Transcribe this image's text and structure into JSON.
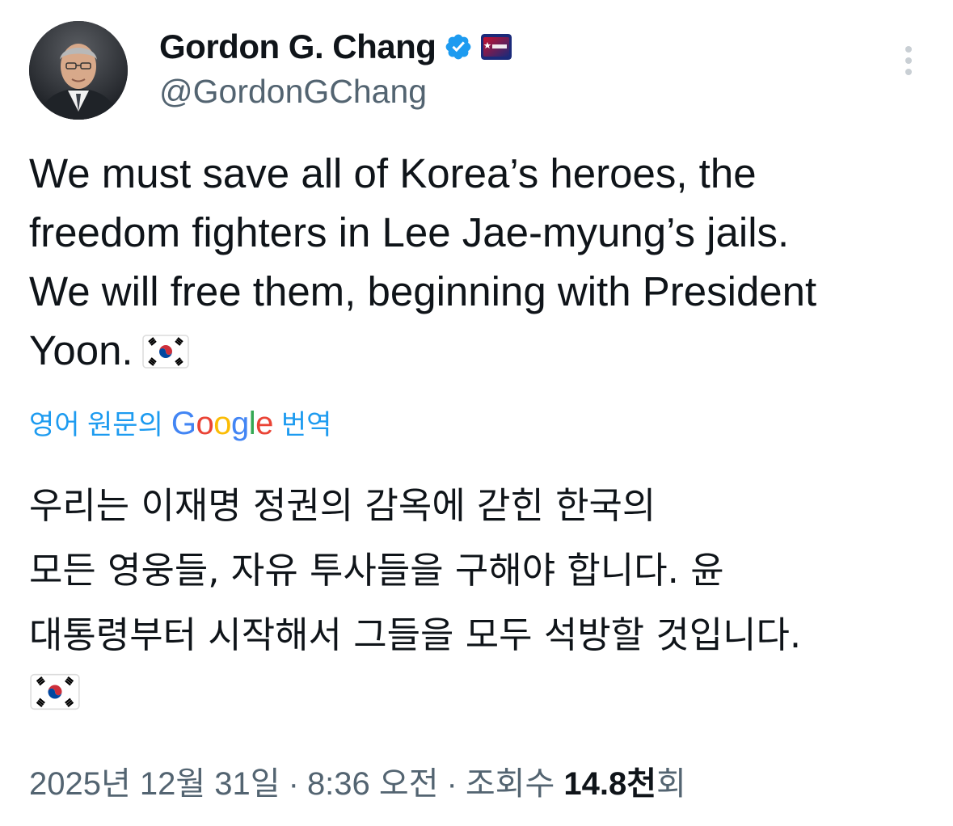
{
  "author": {
    "display_name": "Gordon G. Chang",
    "handle": "@GordonGChang",
    "affiliation_badge": "CPAC"
  },
  "tweet": {
    "text": "We must save all of Korea’s heroes, the\nfreedom fighters in Lee Jae-myung’s jails.\nWe will free them, beginning with President\nYoon.",
    "flag_emoji": "south-korea-flag"
  },
  "translation": {
    "label_prefix": "영어 원문의",
    "label_suffix": "번역",
    "brand_letters": [
      "G",
      "o",
      "o",
      "g",
      "l",
      "e"
    ],
    "text": "우리는 이재명 정권의 감옥에 갇힌 한국의\n모든 영웅들, 자유 투사들을 구해야 합니다. 윤\n대통령부터 시작해서 그들을 모두 석방할 것입니다."
  },
  "meta": {
    "date": "2025년 12월 31일",
    "separator": "·",
    "time": "8:36 오전",
    "views_label": "조회수",
    "views_count": "14.8천",
    "views_suffix": "회"
  },
  "colors": {
    "link": "#1d9bf0",
    "secondary_text": "#536471",
    "verified": "#1d9bf0"
  }
}
